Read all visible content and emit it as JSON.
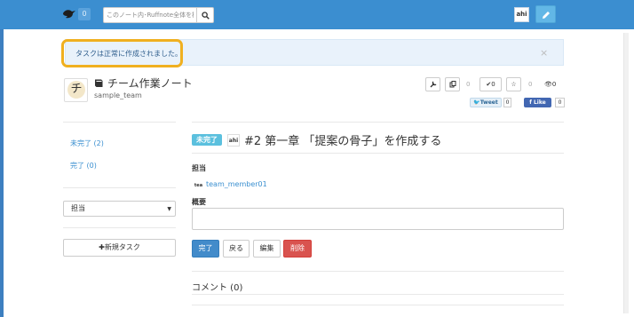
{
  "navbar": {
    "notification_count": "0",
    "search_placeholder": "このノート内･Ruffnote全体を検",
    "user_avatar_text": "ahi"
  },
  "alert": {
    "message": "タスクは正常に作成されました。",
    "close_label": "×"
  },
  "team": {
    "avatar_char": "チ",
    "name": "チーム作業ノート",
    "handle": "sample_team"
  },
  "toolbar": {
    "fork_count": "0",
    "check_label": "0",
    "star_count": "0",
    "watch_count": "0",
    "tweet_label": "Tweet",
    "tweet_count": "0",
    "fb_like_label": "Like",
    "fb_count": "0"
  },
  "sidebar": {
    "incomplete_label": "未完了 (2)",
    "complete_label": "完了 (0)",
    "assignee_select": "担当",
    "new_task_label": "新規タスク"
  },
  "task": {
    "status": "未完了",
    "avatar_text": "ahi",
    "title": "#2 第一章 「提案の骨子」を作成する",
    "assignee_heading": "担当",
    "assignee_icon_text": "tea",
    "assignee_name": "team_member01",
    "summary_heading": "概要",
    "buttons": {
      "complete": "完了",
      "back": "戻る",
      "edit": "編集",
      "delete": "削除"
    },
    "comments_heading": "コメント (0)"
  },
  "colors": {
    "navbar": "#3b8ed0",
    "status_label": "#5bc0de",
    "primary": "#428bca",
    "danger": "#d9534f",
    "highlight": "#f0b020"
  }
}
